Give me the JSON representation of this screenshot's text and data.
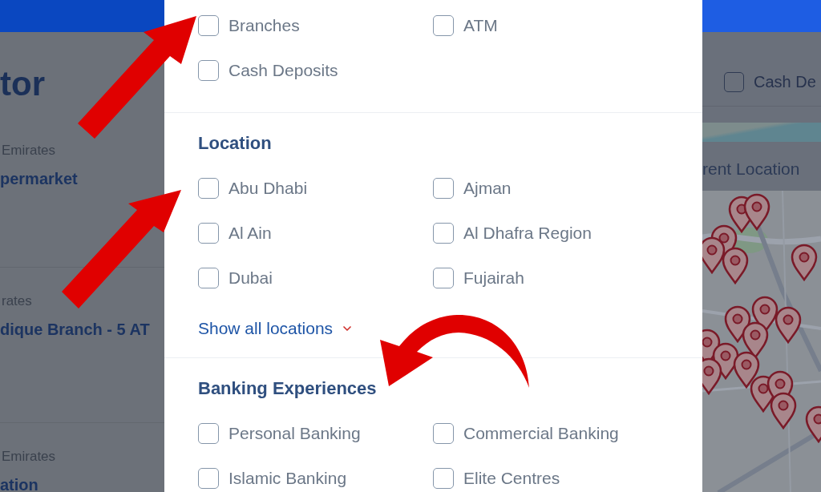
{
  "background_page": {
    "title": "tor",
    "results": [
      {
        "region": "Emirates",
        "name": "permarket"
      },
      {
        "region": "rates",
        "name": "dique Branch - 5 AT"
      },
      {
        "region": "Emirates",
        "name": "ation"
      }
    ],
    "service_filter": {
      "label": "Cash De",
      "checked": false
    },
    "current_location_button": "rent Location"
  },
  "filter_panel": {
    "sections": [
      {
        "options": [
          {
            "label": "Branches",
            "checked": false
          },
          {
            "label": "ATM",
            "checked": false
          },
          {
            "label": "Cash Deposits",
            "checked": false
          }
        ]
      },
      {
        "title": "Location",
        "options": [
          {
            "label": "Abu Dhabi",
            "checked": false
          },
          {
            "label": "Ajman",
            "checked": false
          },
          {
            "label": "Al Ain",
            "checked": false
          },
          {
            "label": "Al Dhafra Region",
            "checked": false
          },
          {
            "label": "Dubai",
            "checked": false
          },
          {
            "label": "Fujairah",
            "checked": false
          }
        ],
        "show_all_link": "Show all locations"
      },
      {
        "title": "Banking Experiences",
        "options": [
          {
            "label": "Personal Banking",
            "checked": false
          },
          {
            "label": "Commercial Banking",
            "checked": false
          },
          {
            "label": "Islamic Banking",
            "checked": false
          },
          {
            "label": "Elite Centres",
            "checked": false
          }
        ]
      }
    ]
  }
}
